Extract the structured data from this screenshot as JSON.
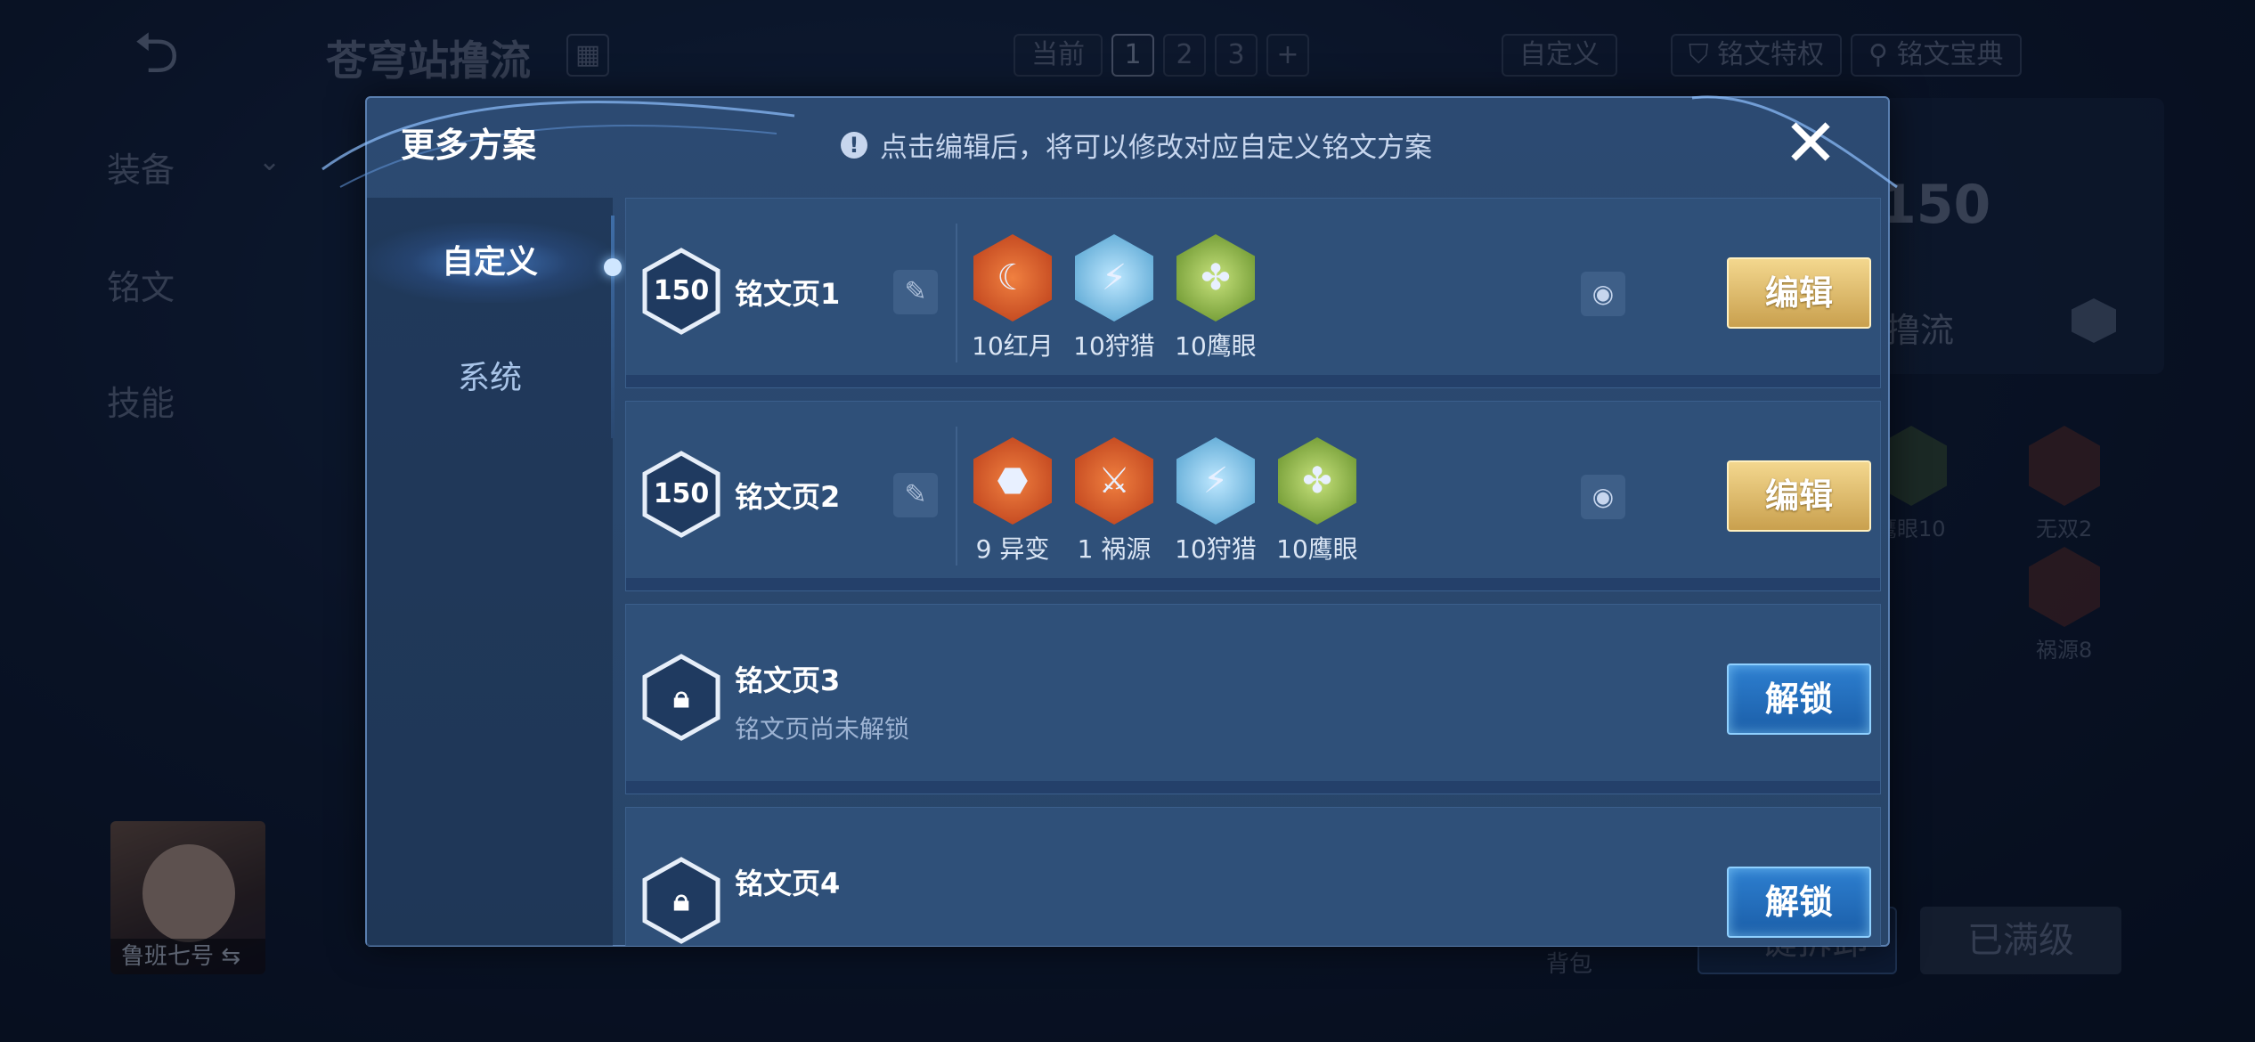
{
  "background": {
    "back_icon": "back-arrow-icon",
    "title": "苍穹站撸流",
    "topbar": {
      "current_label": "当前",
      "pages": [
        "1",
        "2",
        "3"
      ],
      "active_page": "1",
      "add_label": "+",
      "custom_label": "自定义",
      "privilege_label": "铭文特权",
      "codex_label": "铭文宝典"
    },
    "side_menu": [
      "装备",
      "铭文",
      "技能"
    ],
    "right_panel": {
      "level": "150",
      "scheme_name": "站撸流",
      "runes": [
        {
          "label": "鹰眼10"
        },
        {
          "label": "无双2"
        },
        {
          "label": "祸源8"
        }
      ]
    },
    "hero_name": "鲁班七号",
    "bag_label": "背包",
    "buttons": {
      "quick_equip": "一键拆卸",
      "maxed": "已满级"
    }
  },
  "modal": {
    "title": "更多方案",
    "hint": "点击编辑后，将可以修改对应自定义铭文方案",
    "tabs": [
      {
        "label": "自定义",
        "active": true
      },
      {
        "label": "系统",
        "active": false
      }
    ],
    "pages": [
      {
        "name": "铭文页1",
        "level": "150",
        "locked": false,
        "runes": [
          {
            "label": "10红月",
            "color": "#d9532a"
          },
          {
            "label": "10狩猎",
            "color": "#5fb7e0"
          },
          {
            "label": "10鹰眼",
            "color": "#8fbd3c"
          }
        ],
        "button": "编辑"
      },
      {
        "name": "铭文页2",
        "level": "150",
        "locked": false,
        "runes": [
          {
            "label": "9 异变",
            "color": "#d9532a"
          },
          {
            "label": "1 祸源",
            "color": "#d9532a"
          },
          {
            "label": "10狩猎",
            "color": "#5fb7e0"
          },
          {
            "label": "10鹰眼",
            "color": "#8fbd3c"
          }
        ],
        "button": "编辑"
      },
      {
        "name": "铭文页3",
        "locked": true,
        "sub": "铭文页尚未解锁",
        "button": "解锁"
      },
      {
        "name": "铭文页4",
        "locked": true,
        "sub": "",
        "button": "解锁"
      }
    ]
  }
}
